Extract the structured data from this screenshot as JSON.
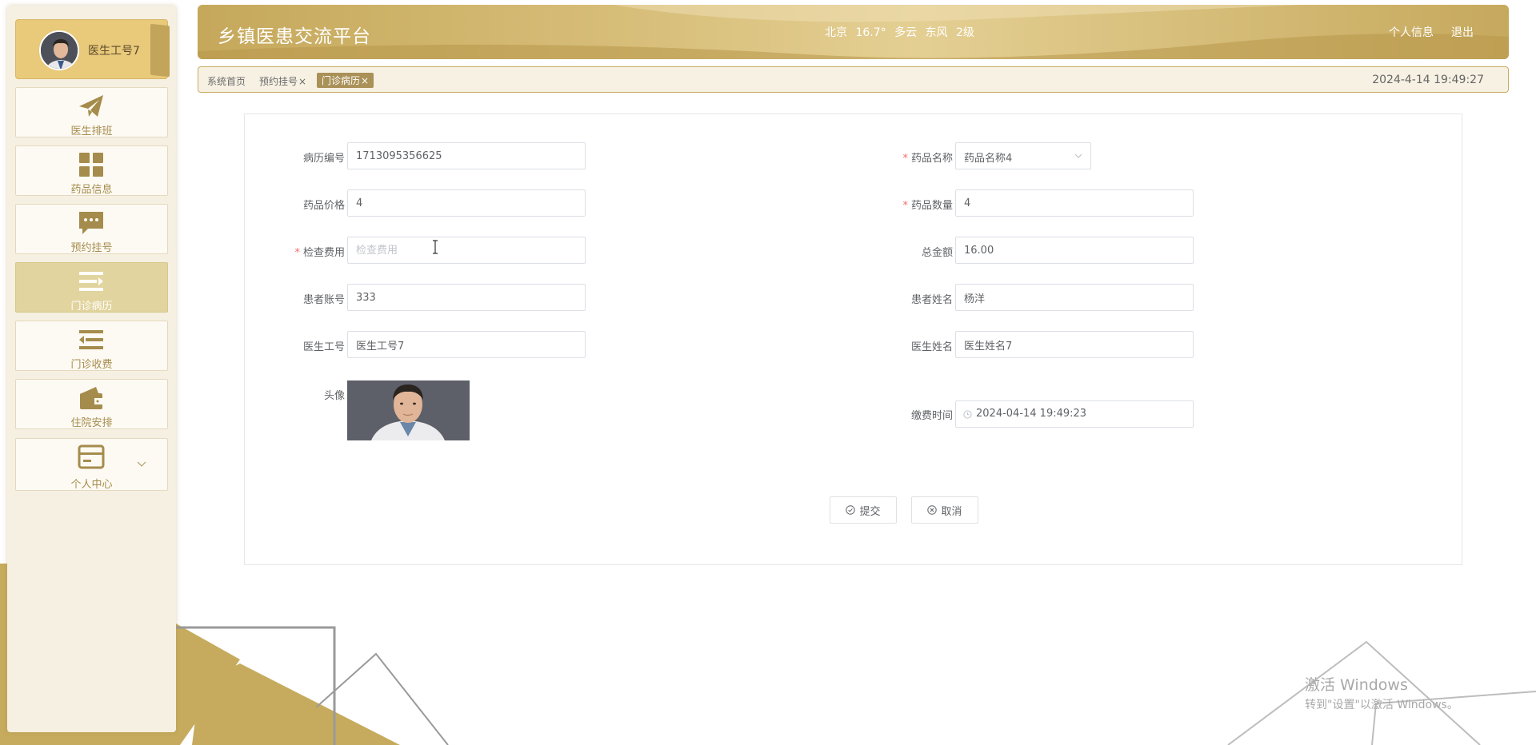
{
  "user": {
    "name": "医生工号7"
  },
  "sidebar": {
    "items": [
      {
        "label": "医生排班",
        "icon": "paper-plane-icon"
      },
      {
        "label": "药品信息",
        "icon": "grid-icon"
      },
      {
        "label": "预约挂号",
        "icon": "chat-bubble-icon"
      },
      {
        "label": "门诊病历",
        "icon": "list-indent-icon",
        "active": true
      },
      {
        "label": "门诊收费",
        "icon": "list-outdent-icon"
      },
      {
        "label": "住院安排",
        "icon": "wallet-icon"
      },
      {
        "label": "个人中心",
        "icon": "card-icon",
        "expandable": true
      }
    ]
  },
  "header": {
    "title": "乡镇医患交流平台",
    "weather": {
      "city": "北京",
      "temp": "16.7°",
      "condition": "多云",
      "wind": "东风",
      "level": "2级"
    },
    "profile_link": "个人信息",
    "logout_link": "退出"
  },
  "tabs": [
    {
      "label": "系统首页",
      "closable": false
    },
    {
      "label": "预约挂号",
      "closable": true
    },
    {
      "label": "门诊病历",
      "closable": true,
      "active": true
    }
  ],
  "tab_close_glyph": "×",
  "datetime": "2024-4-14 19:49:27",
  "form": {
    "record_no": {
      "label": "病历编号",
      "value": "1713095356625"
    },
    "drug_name": {
      "label": "药品名称",
      "value": "药品名称4",
      "required": true
    },
    "drug_price": {
      "label": "药品价格",
      "value": "4"
    },
    "drug_qty": {
      "label": "药品数量",
      "value": "4",
      "required": true
    },
    "exam_fee": {
      "label": "检查费用",
      "value": "",
      "placeholder": "检查费用",
      "required": true
    },
    "total": {
      "label": "总金额",
      "value": "16.00"
    },
    "patient_account": {
      "label": "患者账号",
      "value": "333"
    },
    "patient_name": {
      "label": "患者姓名",
      "value": "杨洋"
    },
    "doctor_id": {
      "label": "医生工号",
      "value": "医生工号7"
    },
    "doctor_name": {
      "label": "医生姓名",
      "value": "医生姓名7"
    },
    "avatar": {
      "label": "头像"
    },
    "pay_time": {
      "label": "缴费时间",
      "value": "2024-04-14 19:49:23"
    },
    "required_mark": "*",
    "submit_label": "提交",
    "cancel_label": "取消"
  },
  "watermark": {
    "line1": "激活 Windows",
    "line2": "转到\"设置\"以激活 Windows。"
  },
  "colors": {
    "accent": "#c5a85b",
    "active_menu": "#e2d49e",
    "required": "#f56c6c"
  }
}
